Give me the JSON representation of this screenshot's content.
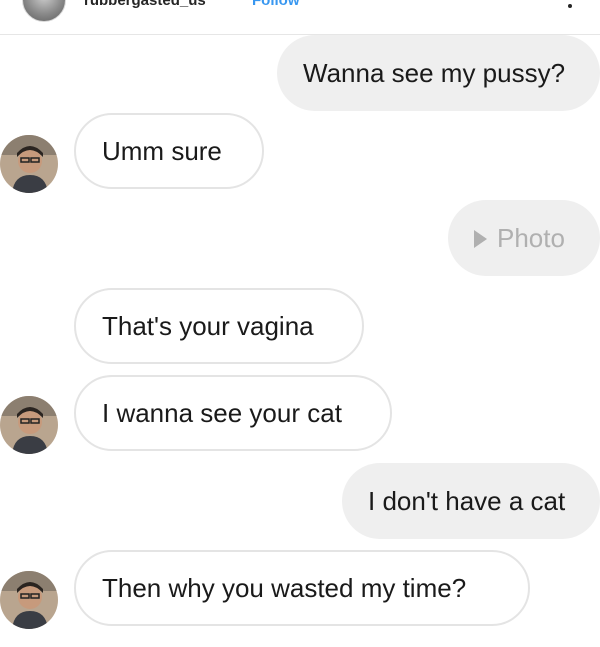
{
  "header": {
    "username": "rubbergasted_us",
    "follow_label": "Follow"
  },
  "messages": [
    {
      "direction": "sent",
      "text": "Wanna see my pussy?"
    },
    {
      "direction": "received",
      "text": "Umm sure"
    },
    {
      "direction": "sent",
      "type": "photo",
      "text": "Photo"
    },
    {
      "direction": "received",
      "text": "That's your vagina"
    },
    {
      "direction": "received",
      "text": "I wanna see your cat"
    },
    {
      "direction": "sent",
      "text": "I don't have a cat"
    },
    {
      "direction": "received",
      "text": "Then why you wasted my time?"
    }
  ],
  "colors": {
    "sent_bubble": "#efefef",
    "received_border": "#e4e4e4",
    "photo_text": "#b0b0b0",
    "follow": "#3897f0"
  },
  "icons": {
    "photo": "play-icon",
    "avatar": "profile-avatar"
  }
}
